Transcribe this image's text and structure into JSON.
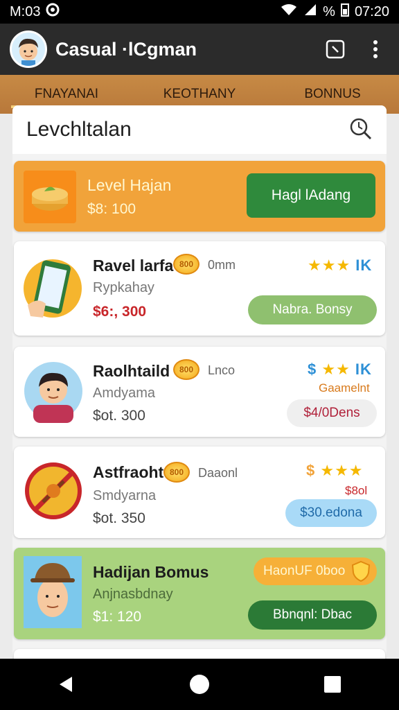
{
  "status": {
    "carrier": "M:03",
    "time": "07:20",
    "battery_text": "%"
  },
  "app": {
    "title": "Casual ·lCgman"
  },
  "tabs": [
    {
      "label": "FNAYANAI"
    },
    {
      "label": "KEOTHANY"
    },
    {
      "label": "BONNUS"
    }
  ],
  "sheet": {
    "title": "Levchltalan"
  },
  "featured": {
    "name": "Level Hajan",
    "price": "$8: 100",
    "button": "Hagl lAdang"
  },
  "cards": [
    {
      "name": "Ravel larfa",
      "sub": "Rypkahay",
      "price": "$6:, 300",
      "coin": "800",
      "tag": "0mm",
      "stars_prefix": "",
      "stars_suffix": "IK",
      "note": "",
      "pill": "Nabra. Bonsy"
    },
    {
      "name": "Raolhtaild",
      "sub": "Amdyama",
      "price": "$ot. 300",
      "coin": "800",
      "tag": "Lnco",
      "stars_prefix": "$",
      "stars_suffix": "IK",
      "note": "Gaamelnt",
      "pill": "$4/0Dens"
    },
    {
      "name": "Astfraoht",
      "sub": "Smdyarna",
      "price": "$ot. 350",
      "coin": "800",
      "tag": "Daaonl",
      "stars_prefix": "$",
      "stars_suffix": "",
      "note": "$8ol",
      "pill": "$30.edona"
    },
    {
      "name": "Hadijan Bomus",
      "sub": "Anjnasbdnay",
      "price": "$1: 120",
      "bonus_pill": "HaonUF 0boo",
      "pill": "Bbnqnl: Dbac"
    }
  ],
  "colors": {
    "accent_orange": "#f1a33a",
    "green_button": "#2f8a3c",
    "bonus_bg": "#a9d37e",
    "tab_bg": "#c78a45"
  }
}
